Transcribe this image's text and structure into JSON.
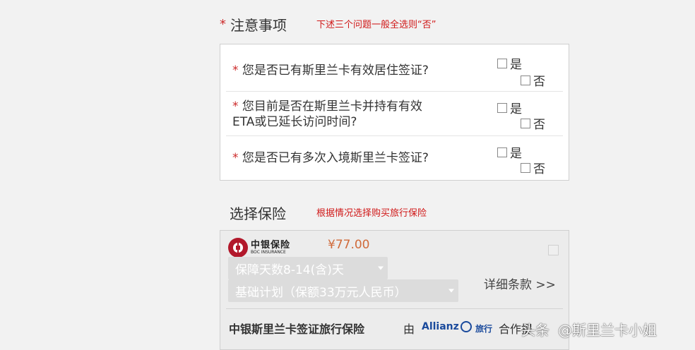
{
  "notice": {
    "asterisk": "*",
    "title": "注意事项",
    "hint": "下述三个问题一般全选则“否”"
  },
  "questions": [
    {
      "asterisk": "*",
      "line1": "您是否已有斯里兰卡有效居住签证?",
      "line2": "",
      "yes": "是",
      "no": "否"
    },
    {
      "asterisk": "*",
      "line1": "您目前是否在斯里兰卡并持有有效",
      "line2": "ETA或已延长访问时间?",
      "yes": "是",
      "no": "否"
    },
    {
      "asterisk": "*",
      "line1": "您是否已有多次入境斯里兰卡签证?",
      "line2": "",
      "yes": "是",
      "no": "否"
    }
  ],
  "insurance": {
    "title": "选择保险",
    "hint": "根据情况选择购买旅行保险",
    "logo_cn": "中银保险",
    "logo_en": "BOC INSURANCE",
    "price": "¥77.00",
    "days_select": "保障天数8-14(含)天",
    "plan_select": "基础计划（保额33万元人民币）",
    "details_link": "详细条款 >>",
    "footer_product": "中银斯里兰卡签证旅行保险",
    "footer_by": "由",
    "partner_logo": "Allianz",
    "partner_suffix": "旅行",
    "footer_tail": "合作提",
    "brand_color": "#b2182b"
  },
  "watermark": {
    "prefix": "头条",
    "handle": "@斯里兰卡小姐"
  }
}
